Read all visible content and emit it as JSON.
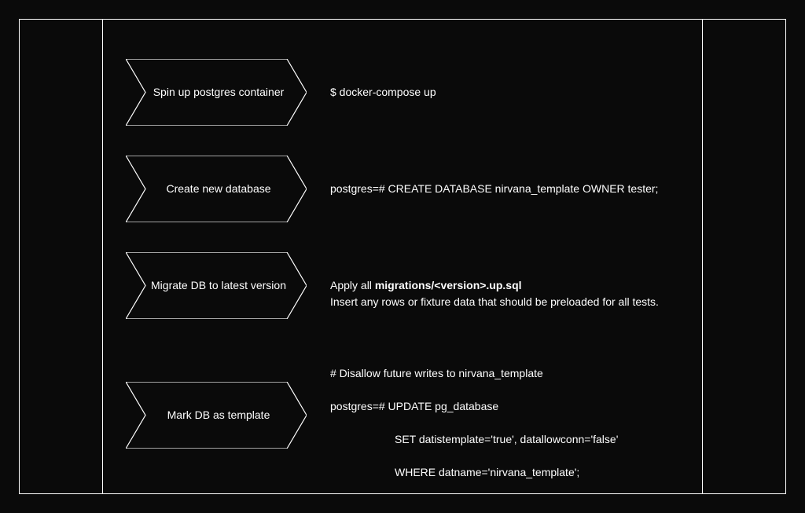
{
  "steps": [
    {
      "label": "Spin up postgres container",
      "desc_plain": "$ docker-compose up"
    },
    {
      "label": "Create new database",
      "desc_plain": "postgres=# CREATE DATABASE nirvana_template OWNER tester;"
    },
    {
      "label": "Migrate DB to latest version",
      "desc_prefix": "Apply all ",
      "desc_bold": "migrations/<version>.up.sql",
      "desc_suffix": "\nInsert any rows or fixture data that should be preloaded for all tests."
    },
    {
      "label": "Mark DB as template",
      "desc_line1": "# Disallow future writes to nirvana_template",
      "desc_line2": "postgres=# UPDATE pg_database",
      "desc_line3": "SET datistemplate='true', datallowconn='false'",
      "desc_line4": "WHERE datname='nirvana_template';"
    }
  ]
}
